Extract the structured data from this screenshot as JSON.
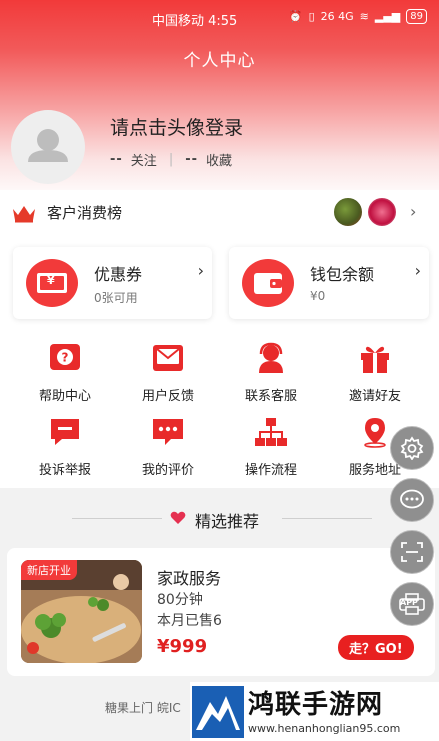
{
  "status_bar": {
    "carrier_time": "中国移动 4:55",
    "signal_text": "26 4G",
    "battery": "89"
  },
  "header": {
    "title": "个人中心"
  },
  "profile": {
    "login_prompt": "请点击头像登录",
    "following_count": "--",
    "following_label": "关注",
    "favorites_count": "--",
    "favorites_label": "收藏"
  },
  "ranking": {
    "label": "客户消费榜",
    "arrow": "›"
  },
  "cards": {
    "coupon": {
      "title": "优惠券",
      "subtitle": "0张可用",
      "icon_text": "¥"
    },
    "wallet": {
      "title": "钱包余额",
      "subtitle": "¥0"
    }
  },
  "grid": {
    "help": "帮助中心",
    "feedback": "用户反馈",
    "service": "联系客服",
    "invite": "邀请好友",
    "complaint": "投诉举报",
    "reviews": "我的评价",
    "process": "操作流程",
    "address": "服务地址"
  },
  "recommend": {
    "title": "精选推荐"
  },
  "product": {
    "tag": "新店开业",
    "name": "家政服务",
    "duration": "80分钟",
    "sold": "本月已售6",
    "price": "¥999",
    "go_button": "走？GO!"
  },
  "footer": {
    "text": "糖果上门 皖IC"
  },
  "floating": {
    "app_label": "APP"
  },
  "watermark": {
    "title": "鸿联手游网",
    "url": "www.henanhonglian95.com"
  },
  "colors": {
    "accent": "#f23a3a",
    "price": "#e02020"
  }
}
